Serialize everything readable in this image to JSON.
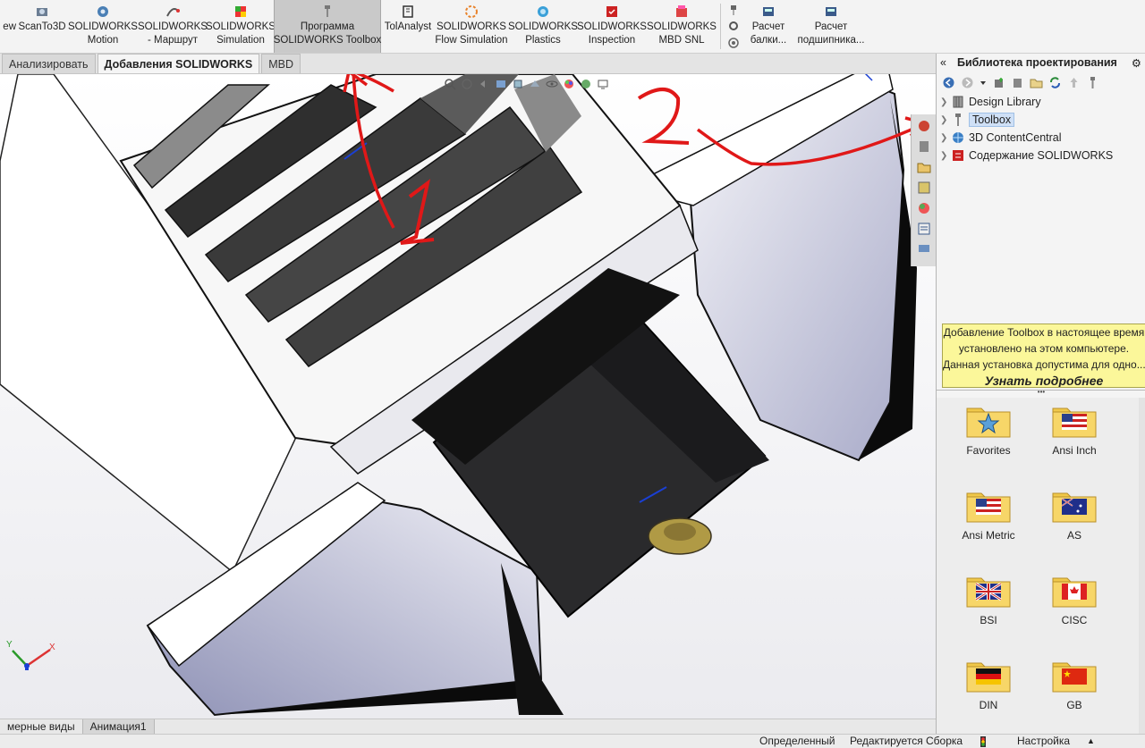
{
  "ribbon": {
    "items": [
      {
        "label": "ew",
        "icon": "view-icon"
      },
      {
        "label": "ScanTo3D",
        "icon": "scanto3d-icon"
      },
      {
        "label": "SOLIDWORKS\nMotion",
        "icon": "motion-icon"
      },
      {
        "label": "SOLIDWORKS\n- Маршрут",
        "icon": "routing-icon"
      },
      {
        "label": "SOLIDWORKS\nSimulation",
        "icon": "simulation-icon"
      },
      {
        "label": "Программа\nSOLIDWORKS Toolbox",
        "icon": "toolbox-screw-icon",
        "active": true
      },
      {
        "label": "TolAnalyst",
        "icon": "tolanalyst-icon"
      },
      {
        "label": "SOLIDWORKS\nFlow Simulation",
        "icon": "flow-simulation-icon"
      },
      {
        "label": "SOLIDWORKS\nPlastics",
        "icon": "plastics-icon"
      },
      {
        "label": "SOLIDWORKS\nInspection",
        "icon": "inspection-icon"
      },
      {
        "label": "SOLIDWORKS\nMBD SNL",
        "icon": "mbd-snl-icon"
      },
      {
        "label": "Расчет\nбалки...",
        "icon": "beam-calc-icon"
      },
      {
        "label": "Расчет\nподшипника...",
        "icon": "bearing-calc-icon"
      }
    ]
  },
  "tabs": [
    {
      "label": "Анализировать",
      "selected": false
    },
    {
      "label": "Добавления SOLIDWORKS",
      "selected": true
    },
    {
      "label": "MBD",
      "selected": false
    }
  ],
  "annotations": {
    "label_1": "1",
    "label_2": "2",
    "color": "#e01818"
  },
  "bottom_tabs": [
    {
      "label": "мерные виды",
      "selected": false
    },
    {
      "label": "Анимация1",
      "selected": true
    }
  ],
  "status": {
    "defined": "Определенный",
    "editing": "Редактируется Сборка",
    "custom": "Настройка"
  },
  "taskpane": {
    "title": "Библиотека проектирования",
    "tree": [
      {
        "label": "Design Library",
        "icon": "design-library-icon",
        "selected": false
      },
      {
        "label": "Toolbox",
        "icon": "toolbox-icon",
        "selected": true
      },
      {
        "label": "3D ContentCentral",
        "icon": "globe-icon",
        "selected": false
      },
      {
        "label": "Содержание SOLIDWORKS",
        "icon": "sw-content-icon",
        "selected": false
      }
    ],
    "notice": {
      "line1": "Добавление Toolbox в настоящее время",
      "line2": "установлено на этом компьютере.",
      "line3": "Данная установка допустима для одно...",
      "more": "Узнать подробнее"
    },
    "folders": [
      {
        "label": "Favorites",
        "icon": "star-folder-icon"
      },
      {
        "label": "Ansi Inch",
        "icon": "us-flag-folder-icon"
      },
      {
        "label": "Ansi Metric",
        "icon": "us-flag-folder-icon"
      },
      {
        "label": "AS",
        "icon": "au-flag-folder-icon"
      },
      {
        "label": "BSI",
        "icon": "uk-flag-folder-icon"
      },
      {
        "label": "CISC",
        "icon": "ca-flag-folder-icon"
      },
      {
        "label": "DIN",
        "icon": "de-flag-folder-icon"
      },
      {
        "label": "GB",
        "icon": "cn-flag-folder-icon"
      }
    ]
  },
  "triad": {
    "x": "X",
    "y": "Y"
  }
}
